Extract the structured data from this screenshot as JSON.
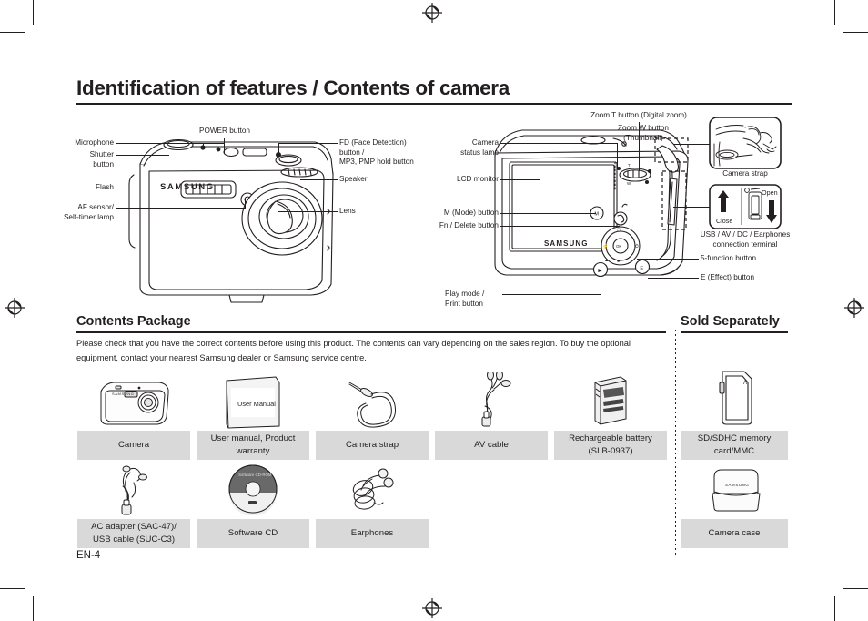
{
  "page": {
    "title": "Identification of features / Contents of camera",
    "page_number": "EN-4"
  },
  "front_view": {
    "labels": [
      {
        "id": "microphone",
        "text": "Microphone"
      },
      {
        "id": "shutter-button",
        "text": "Shutter\nbutton"
      },
      {
        "id": "flash",
        "text": "Flash"
      },
      {
        "id": "af-sensor",
        "text": "AF sensor/\nSelf-timer lamp"
      },
      {
        "id": "power-button",
        "text": "POWER button"
      },
      {
        "id": "fd-button",
        "text": "FD (Face Detection)\nbutton /\nMP3, PMP hold button"
      },
      {
        "id": "speaker",
        "text": "Speaker"
      },
      {
        "id": "lens",
        "text": "Lens"
      }
    ],
    "brand": "SAMSUNG"
  },
  "back_view": {
    "labels": [
      {
        "id": "camera-status-lamp",
        "text": "Camera\nstatus lamp"
      },
      {
        "id": "lcd-monitor",
        "text": "LCD monitor"
      },
      {
        "id": "mode-button",
        "text": "M (Mode) button"
      },
      {
        "id": "fn-delete-button",
        "text": "Fn / Delete button"
      },
      {
        "id": "play-mode-print-button",
        "text": "Play mode /\n Print button"
      },
      {
        "id": "zoom-t-button",
        "text": "Zoom T button (Digital zoom)"
      },
      {
        "id": "zoom-w-button",
        "text": "Zoom W button\n(Thumbnail)"
      },
      {
        "id": "five-function-button",
        "text": "5-function button"
      },
      {
        "id": "effect-button",
        "text": "E (Effect) button"
      }
    ],
    "brand": "SAMSUNG"
  },
  "insets": [
    {
      "id": "camera-strap",
      "caption": "Camera strap"
    },
    {
      "id": "connection-terminal",
      "caption": "USB / AV / DC / Earphones\nconnection terminal",
      "open_label": "Open",
      "close_label": "Close"
    }
  ],
  "contents": {
    "heading": "Contents Package",
    "intro": "Please check that you have the correct contents before using this product. The contents can vary depending on the sales region. To buy the optional equipment, contact your nearest Samsung dealer or Samsung service centre.",
    "items": [
      {
        "id": "camera",
        "caption": "Camera",
        "icon": "camera-icon"
      },
      {
        "id": "user-manual",
        "caption": "User manual,\nProduct warranty",
        "icon": "manual-icon",
        "icon_text": "User Manual"
      },
      {
        "id": "camera-strap",
        "caption": "Camera strap",
        "icon": "strap-icon"
      },
      {
        "id": "av-cable",
        "caption": "AV cable",
        "icon": "av-cable-icon"
      },
      {
        "id": "rechargeable-battery",
        "caption": "Rechargeable battery\n(SLB-0937)",
        "icon": "battery-icon"
      },
      {
        "id": "ac-adapter",
        "caption": "AC adapter (SAC-47)/\nUSB cable (SUC-C3)",
        "icon": "usb-cable-icon"
      },
      {
        "id": "software-cd",
        "caption": "Software CD",
        "icon": "cd-icon",
        "icon_text": "Software CD-ROM"
      },
      {
        "id": "earphones",
        "caption": "Earphones",
        "icon": "earphones-icon"
      }
    ]
  },
  "sold_separately": {
    "heading": "Sold Separately",
    "items": [
      {
        "id": "memory-card",
        "caption": "SD/SDHC memory\ncard/MMC",
        "icon": "sd-card-icon"
      },
      {
        "id": "camera-case",
        "caption": "Camera case",
        "icon": "camera-case-icon",
        "icon_text": "SAMSUNG"
      }
    ]
  }
}
